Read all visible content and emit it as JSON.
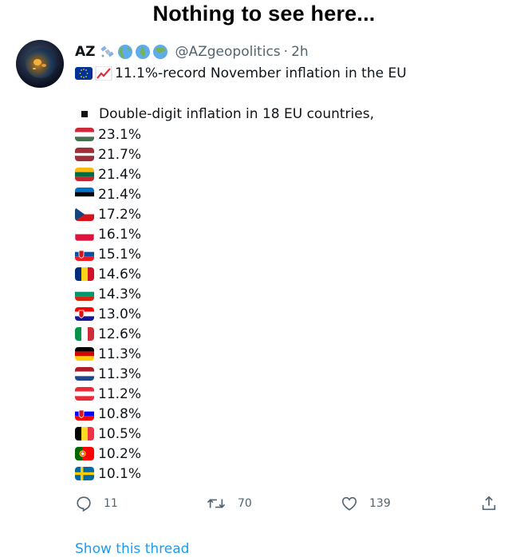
{
  "caption": "Nothing to see here...",
  "tweet": {
    "display_name": "AZ",
    "name_emojis": [
      "satellite-icon",
      "globe-americas-icon",
      "globe-europe-africa-icon",
      "globe-asia-icon"
    ],
    "handle": "@AZgeopolitics",
    "separator": "·",
    "time": "2h",
    "line1_emojis": [
      "eu-flag-icon",
      "chart-increasing-icon"
    ],
    "line1_text": "11.1%-record November inflation in the EU",
    "intro_text": "Double-digit inflation in 18 EU countries,",
    "countries": [
      {
        "flag": "hungary-flag-icon",
        "value": "23.1%",
        "colors": [
          "#ce2939",
          "#ffffff",
          "#477050"
        ],
        "layout": "h3"
      },
      {
        "flag": "latvia-flag-icon",
        "value": "21.7%",
        "colors": [
          "#9e3039",
          "#ffffff",
          "#9e3039"
        ],
        "layout": "latvia"
      },
      {
        "flag": "lithuania-flag-icon",
        "value": "21.4%",
        "colors": [
          "#fdb913",
          "#006a44",
          "#c1272d"
        ],
        "layout": "h3"
      },
      {
        "flag": "estonia-flag-icon",
        "value": "21.4%",
        "colors": [
          "#0072ce",
          "#000000",
          "#ffffff"
        ],
        "layout": "h3"
      },
      {
        "flag": "czechia-flag-icon",
        "value": "17.2%",
        "colors": [
          "#ffffff",
          "#d7141a",
          "#11457e"
        ],
        "layout": "czech"
      },
      {
        "flag": "poland-flag-icon",
        "value": "16.1%",
        "colors": [
          "#ffffff",
          "#dc143c"
        ],
        "layout": "h2"
      },
      {
        "flag": "slovakia-flag-icon",
        "value": "15.1%",
        "colors": [
          "#ffffff",
          "#0b4ea2",
          "#ee1c25"
        ],
        "layout": "h3crest"
      },
      {
        "flag": "romania-flag-icon",
        "value": "14.6%",
        "colors": [
          "#002b7f",
          "#fcd116",
          "#ce1126"
        ],
        "layout": "v3"
      },
      {
        "flag": "bulgaria-flag-icon",
        "value": "14.3%",
        "colors": [
          "#ffffff",
          "#00966e",
          "#d62612"
        ],
        "layout": "h3"
      },
      {
        "flag": "croatia-flag-icon",
        "value": "13.0%",
        "colors": [
          "#ff0000",
          "#ffffff",
          "#171796"
        ],
        "layout": "h3crest"
      },
      {
        "flag": "italy-flag-icon",
        "value": "12.6%",
        "colors": [
          "#009246",
          "#ffffff",
          "#ce2b37"
        ],
        "layout": "v3"
      },
      {
        "flag": "germany-flag-icon",
        "value": "11.3%",
        "colors": [
          "#000000",
          "#dd0000",
          "#ffce00"
        ],
        "layout": "h3"
      },
      {
        "flag": "netherlands-flag-icon",
        "value": "11.3%",
        "colors": [
          "#ae1c28",
          "#ffffff",
          "#21468b"
        ],
        "layout": "h3"
      },
      {
        "flag": "austria-flag-icon",
        "value": "11.2%",
        "colors": [
          "#ed2939",
          "#ffffff",
          "#ed2939"
        ],
        "layout": "h3"
      },
      {
        "flag": "slovenia-flag-icon",
        "value": "10.8%",
        "colors": [
          "#ffffff",
          "#0000ff",
          "#ff0000"
        ],
        "layout": "h3crest"
      },
      {
        "flag": "belgium-flag-icon",
        "value": "10.5%",
        "colors": [
          "#000000",
          "#fdda24",
          "#ef3340"
        ],
        "layout": "v3"
      },
      {
        "flag": "portugal-flag-icon",
        "value": "10.2%",
        "colors": [
          "#006600",
          "#ff0000",
          "#ffcc00"
        ],
        "layout": "portugal"
      },
      {
        "flag": "sweden-flag-icon",
        "value": "10.1%",
        "colors": [
          "#006aa7",
          "#fecc00"
        ],
        "layout": "nordic"
      }
    ],
    "actions": {
      "reply_count": "11",
      "retweet_count": "70",
      "like_count": "139"
    },
    "show_thread": "Show this thread"
  },
  "colors": {
    "text": "#0f1419",
    "secondary": "#536471",
    "link": "#1d9bf0"
  }
}
